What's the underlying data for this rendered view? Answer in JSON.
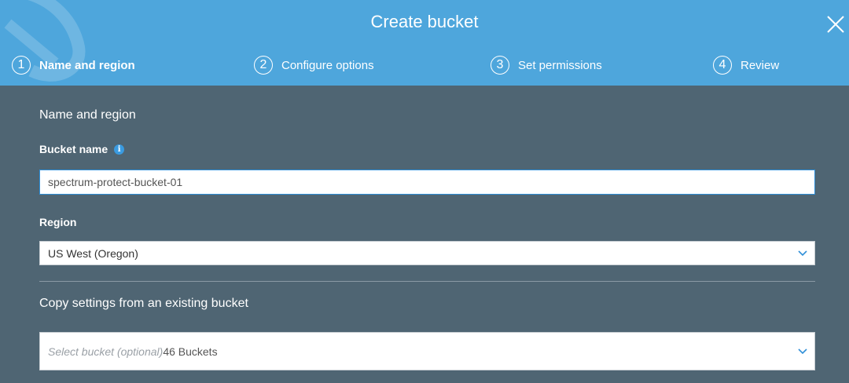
{
  "dialog": {
    "title": "Create bucket"
  },
  "steps": [
    {
      "number": "1",
      "label": "Name and region",
      "active": true
    },
    {
      "number": "2",
      "label": "Configure options",
      "active": false
    },
    {
      "number": "3",
      "label": "Set permissions",
      "active": false
    },
    {
      "number": "4",
      "label": "Review",
      "active": false
    }
  ],
  "form": {
    "section_title": "Name and region",
    "bucket_name_label": "Bucket name",
    "bucket_name_value": "spectrum-protect-bucket-01",
    "region_label": "Region",
    "region_value": "US West (Oregon)",
    "copy_settings_title": "Copy settings from an existing bucket",
    "copy_select_placeholder": "Select bucket (optional)",
    "copy_select_count": "46 Buckets"
  },
  "icons": {
    "close": "close-icon",
    "info": "info-icon",
    "chevron": "chevron-down-icon"
  },
  "colors": {
    "header_bg": "#4ea6dc",
    "body_bg": "#4f6573",
    "input_focus_border": "#2f8fd8",
    "info_icon": "#3a9be0"
  }
}
